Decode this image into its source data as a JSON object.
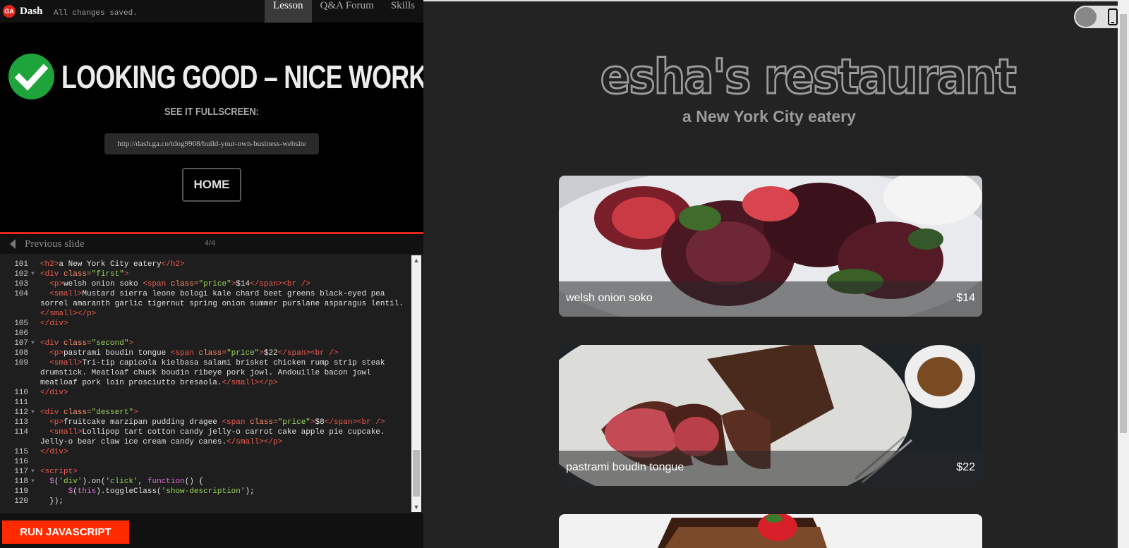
{
  "app": {
    "logo": "GA",
    "name": "Dash",
    "status": "All changes saved."
  },
  "nav": {
    "tabs": [
      "Lesson",
      "Q&A Forum",
      "Skills"
    ]
  },
  "success": {
    "headline": "LOOKING GOOD – NICE WORK!",
    "fullscreen_label": "SEE IT FULLSCREEN:",
    "url": "http://dash.ga.co/tdog9908/build-your-own-business-website",
    "home_label": "HOME"
  },
  "slide": {
    "prev_label": "Previous slide",
    "counter": "4/4"
  },
  "editor": {
    "lines": [
      {
        "n": "101",
        "fold": false,
        "html": "<span class=\"tg\">&lt;h2&gt;</span>a New York City eatery<span class=\"tg\">&lt;/h2&gt;</span>"
      },
      {
        "n": "102",
        "fold": true,
        "html": "<span class=\"tg\">&lt;div</span> <span class=\"at\">class=</span><span class=\"st\">\"first\"</span><span class=\"tg\">&gt;</span>"
      },
      {
        "n": "103",
        "fold": false,
        "html": "  <span class=\"tg\">&lt;p&gt;</span>welsh onion soko <span class=\"tg\">&lt;span</span> <span class=\"at\">class=</span><span class=\"st\">\"price\"</span><span class=\"tg\">&gt;</span>$14<span class=\"tg\">&lt;/span&gt;&lt;br /&gt;</span>"
      },
      {
        "n": "104",
        "fold": false,
        "html": "  <span class=\"tg\">&lt;small&gt;</span>Mustard sierra leone bologi kale chard beet greens black-eyed pea"
      },
      {
        "n": "",
        "fold": false,
        "html": "sorrel amaranth garlic tigernut spring onion summer purslane asparagus lentil."
      },
      {
        "n": "",
        "fold": false,
        "html": "<span class=\"tg\">&lt;/small&gt;&lt;/p&gt;</span>"
      },
      {
        "n": "105",
        "fold": false,
        "html": "<span class=\"tg\">&lt;/div&gt;</span>"
      },
      {
        "n": "106",
        "fold": false,
        "html": ""
      },
      {
        "n": "107",
        "fold": true,
        "html": "<span class=\"tg\">&lt;div</span> <span class=\"at\">class=</span><span class=\"st\">\"second\"</span><span class=\"tg\">&gt;</span>"
      },
      {
        "n": "108",
        "fold": false,
        "html": "  <span class=\"tg\">&lt;p&gt;</span>pastrami boudin tongue <span class=\"tg\">&lt;span</span> <span class=\"at\">class=</span><span class=\"st\">\"price\"</span><span class=\"tg\">&gt;</span>$22<span class=\"tg\">&lt;/span&gt;&lt;br /&gt;</span>"
      },
      {
        "n": "109",
        "fold": false,
        "html": "  <span class=\"tg\">&lt;small&gt;</span>Tri-tip capicola kielbasa salami brisket chicken rump strip steak"
      },
      {
        "n": "",
        "fold": false,
        "html": "drumstick. Meatloaf chuck boudin ribeye pork jowl. Andouille bacon jowl"
      },
      {
        "n": "",
        "fold": false,
        "html": "meatloaf pork loin prosciutto bresaola.<span class=\"tg\">&lt;/small&gt;&lt;/p&gt;</span>"
      },
      {
        "n": "110",
        "fold": false,
        "html": "<span class=\"tg\">&lt;/div&gt;</span>"
      },
      {
        "n": "111",
        "fold": false,
        "html": ""
      },
      {
        "n": "112",
        "fold": true,
        "html": "<span class=\"tg\">&lt;div</span> <span class=\"at\">class=</span><span class=\"st\">\"dessert\"</span><span class=\"tg\">&gt;</span>"
      },
      {
        "n": "113",
        "fold": false,
        "html": "  <span class=\"tg\">&lt;p&gt;</span>fruitcake marzipan pudding dragee <span class=\"tg\">&lt;span</span> <span class=\"at\">class=</span><span class=\"st\">\"price\"</span><span class=\"tg\">&gt;</span>$8<span class=\"tg\">&lt;/span&gt;&lt;br /&gt;</span>"
      },
      {
        "n": "114",
        "fold": false,
        "html": "  <span class=\"tg\">&lt;small&gt;</span>Lollipop tart cotton candy jelly-o carrot cake apple pie cupcake."
      },
      {
        "n": "",
        "fold": false,
        "html": "Jelly-o bear claw ice cream candy canes.<span class=\"tg\">&lt;/small&gt;&lt;/p&gt;</span>"
      },
      {
        "n": "115",
        "fold": false,
        "html": "<span class=\"tg\">&lt;/div&gt;</span>"
      },
      {
        "n": "116",
        "fold": false,
        "html": ""
      },
      {
        "n": "117",
        "fold": true,
        "html": "<span class=\"tg\">&lt;script&gt;</span>"
      },
      {
        "n": "118",
        "fold": true,
        "html": "  <span class=\"kw\">$</span>(<span class=\"st\">'div'</span>).on(<span class=\"st\">'click'</span>, <span class=\"kw\">function</span>() {"
      },
      {
        "n": "119",
        "fold": false,
        "html": "      <span class=\"kw\">$</span>(<span class=\"kw\">this</span>).toggleClass(<span class=\"st\">'show-description'</span>);"
      },
      {
        "n": "120",
        "fold": false,
        "html": "  });"
      }
    ]
  },
  "run": {
    "label": "RUN JAVASCRIPT"
  },
  "preview": {
    "title": "esha's restaurant",
    "subtitle": "a New York City eatery",
    "items": [
      {
        "name": "welsh onion soko",
        "price": "$14"
      },
      {
        "name": "pastrami boudin tongue",
        "price": "$22"
      }
    ]
  },
  "colors": {
    "accent": "#e1251b",
    "run_button": "#ff2a00",
    "check": "#1fa33b"
  },
  "icons": [
    "ga-logo-icon",
    "checkmark-icon",
    "chevron-left-icon",
    "mobile-phone-icon",
    "toggle-icon"
  ]
}
